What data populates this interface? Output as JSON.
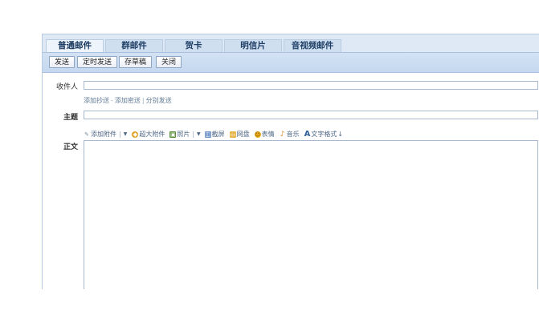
{
  "tabs": [
    {
      "label": "普通邮件",
      "active": true
    },
    {
      "label": "群邮件",
      "active": false
    },
    {
      "label": "贺卡",
      "active": false
    },
    {
      "label": "明信片",
      "active": false
    },
    {
      "label": "音视频邮件",
      "active": false
    }
  ],
  "toolbar": {
    "send": "发送",
    "scheduled_send": "定时发送",
    "save_draft": "存草稿",
    "close": "关闭"
  },
  "fields": {
    "recipient_label": "收件人",
    "subject_label": "主题",
    "body_label": "正文",
    "recipient_value": "",
    "subject_value": ""
  },
  "recipient_links": {
    "add_cc": "添加抄送",
    "sep1": "-",
    "add_bcc": "添加密送",
    "sep2": "|",
    "separate_send": "分别发送"
  },
  "attach_bar": {
    "add_attachment": "添加附件",
    "large_attachment": "超大附件",
    "photo": "照片",
    "screenshot": "截屏",
    "netdisk": "网盘",
    "emoji": "表情",
    "music": "音乐",
    "text_format": "文字格式",
    "text_format_suffix": "↓",
    "text_format_icon": "A"
  },
  "colors": {
    "tab_text": "#1f3f66",
    "toolbar_bg": "#c5d8ef",
    "link": "#5f7896"
  }
}
